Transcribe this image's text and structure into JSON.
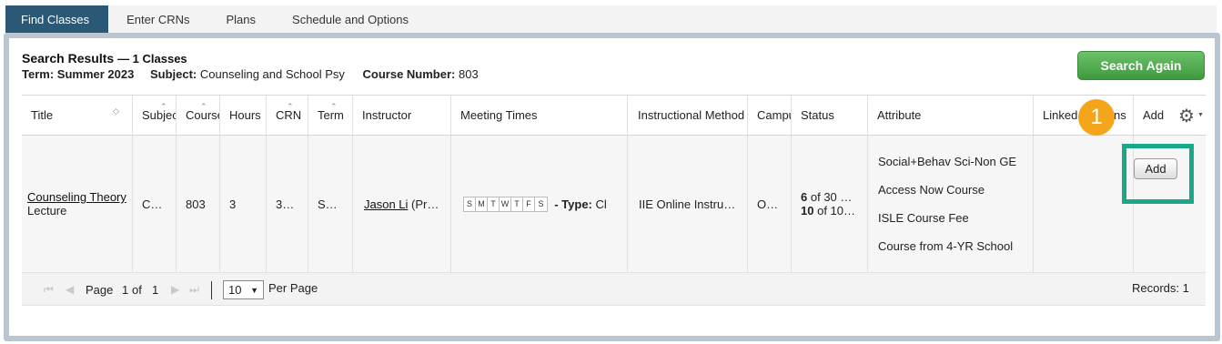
{
  "tabs": [
    {
      "label": "Find Classes",
      "active": true
    },
    {
      "label": "Enter CRNs"
    },
    {
      "label": "Plans"
    },
    {
      "label": "Schedule and Options"
    }
  ],
  "header": {
    "title": "Search Results",
    "count": "— 1 Classes",
    "term_label": "Term:",
    "term_value": "Summer 2023",
    "subject_label": "Subject:",
    "subject_value": "Counseling and School Psy",
    "course_label": "Course Number:",
    "course_value": "803",
    "search_again": "Search Again"
  },
  "columns": [
    "Title",
    "Subject",
    "Course",
    "Hours",
    "CRN",
    "Term",
    "Instructor",
    "Meeting Times",
    "Instructional Method",
    "Campus",
    "Status",
    "Attribute",
    "Linked Sections",
    "Add"
  ],
  "row": {
    "title_link": "Counseling Theory",
    "title_sub": "Lecture",
    "subject": "C…",
    "course": "803",
    "hours": "3",
    "crn": "3…",
    "term": "S…",
    "instructor_link": "Jason Li",
    "instructor_suffix": "(Pr…",
    "days": [
      "S",
      "M",
      "T",
      "W",
      "T",
      "F",
      "S"
    ],
    "type_label": "- Type:",
    "type_value": "Cl",
    "method": "IIE Online Instru…",
    "campus": "O…",
    "status_line1_num": "6",
    "status_line1_rest": "of 30 …",
    "status_line2_num": "10",
    "status_line2_rest": "of 10…",
    "attributes": [
      "Social+Behav Sci-Non GE",
      "Access Now Course",
      "ISLE Course Fee",
      "Course from 4-YR School"
    ],
    "add_button": "Add"
  },
  "pagination": {
    "page_label": "Page",
    "page": "1",
    "of_label": "of",
    "total": "1",
    "per_page_value": "10",
    "per_page_label": "Per Page",
    "records": "Records: 1"
  },
  "annotation": {
    "marker": "1",
    "color": "#1aa889",
    "marker_color": "#f4a51a"
  },
  "icons": {
    "settings": "gear-icon",
    "first": "first-page-icon",
    "prev": "prev-page-icon",
    "next": "next-page-icon",
    "last": "last-page-icon",
    "sort": "sort-icon"
  }
}
